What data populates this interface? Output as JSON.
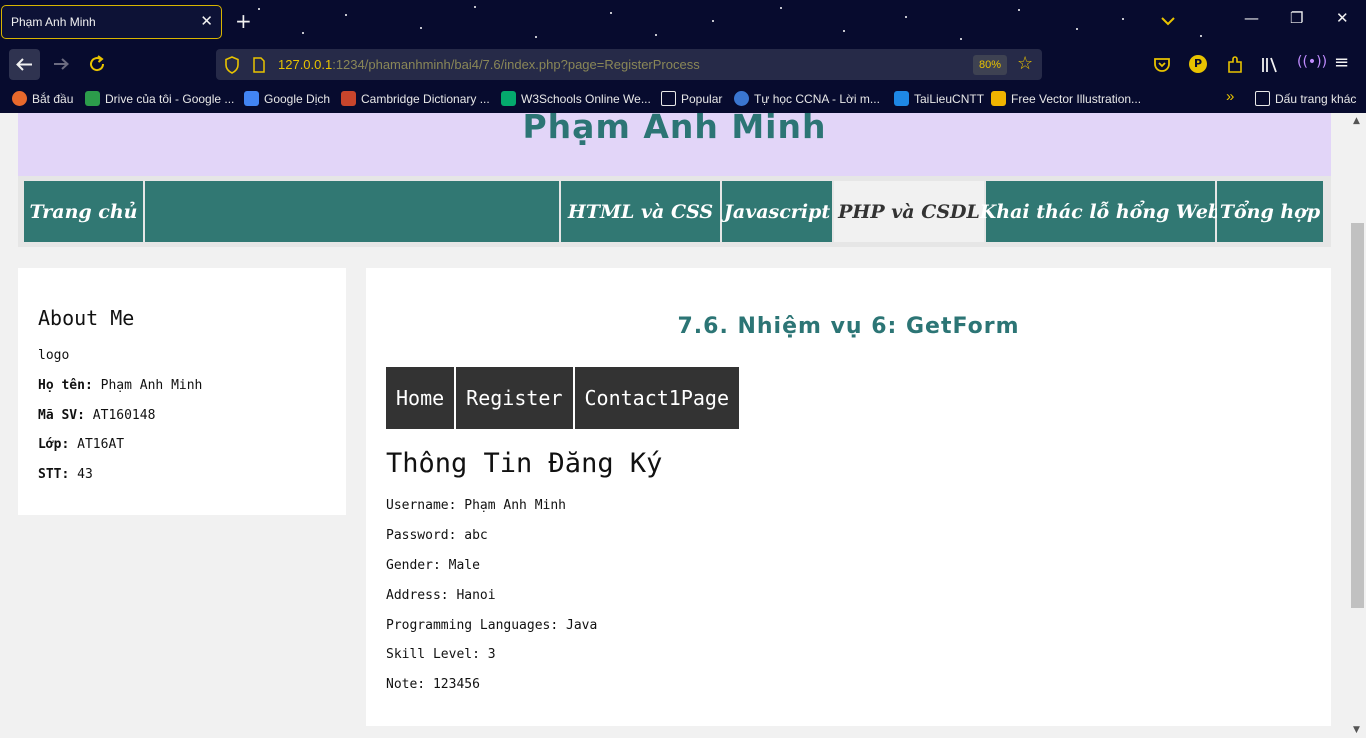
{
  "browser": {
    "tab_title": "Phạm Anh Minh",
    "url_host": "127.0.0.1",
    "url_path": ":1234/phamanhminh/bai4/7.6/index.php?page=RegisterProcess",
    "zoom": "80%",
    "bookmarks": [
      {
        "label": "Bắt đầu",
        "color": "#e8692c"
      },
      {
        "label": "Drive của tôi - Google ...",
        "color": "#2c9c4b"
      },
      {
        "label": "Google Dịch",
        "color": "#4285f4"
      },
      {
        "label": "Cambridge Dictionary ...",
        "color": "#c8452c"
      },
      {
        "label": "W3Schools Online We...",
        "color": "#04aa6d"
      },
      {
        "label": "Popular",
        "color": "#e8e8e8"
      },
      {
        "label": "Tự học CCNA - Lời m...",
        "color": "#3a76d0"
      },
      {
        "label": "TaiLieuCNTT",
        "color": "#1e88e5"
      },
      {
        "label": "Free Vector Illustration...",
        "color": "#f0b400"
      },
      {
        "label": "Dấu trang khác",
        "color": "#e8e8e8"
      }
    ]
  },
  "site": {
    "title": "Phạm Anh Minh",
    "menu": [
      {
        "label": "Trang chủ",
        "active": false
      },
      {
        "label": "HTML và CSS",
        "active": false
      },
      {
        "label": "Javascript",
        "active": false
      },
      {
        "label": "PHP và CSDL",
        "active": true
      },
      {
        "label": "Khai thác lỗ hổng Web",
        "active": false
      },
      {
        "label": "Tổng hợp",
        "active": false
      }
    ]
  },
  "sidebar": {
    "title": "About Me",
    "logo_alt": "logo",
    "fields": [
      {
        "label": "Họ tên:",
        "value": "Phạm Anh Minh"
      },
      {
        "label": "Mã SV:",
        "value": "AT160148"
      },
      {
        "label": "Lớp:",
        "value": "AT16AT"
      },
      {
        "label": "STT:",
        "value": "43"
      }
    ]
  },
  "main": {
    "title": "7.6. Nhiệm vụ 6: GetForm",
    "subnav": [
      "Home",
      "Register",
      "Contact1Page"
    ],
    "heading": "Thông Tin Đăng Ký",
    "lines": [
      "Username: Phạm Anh Minh",
      "Password: abc",
      "Gender: Male",
      "Address: Hanoi",
      "Programming Languages: Java",
      "Skill Level: 3",
      "Note: 123456"
    ]
  }
}
